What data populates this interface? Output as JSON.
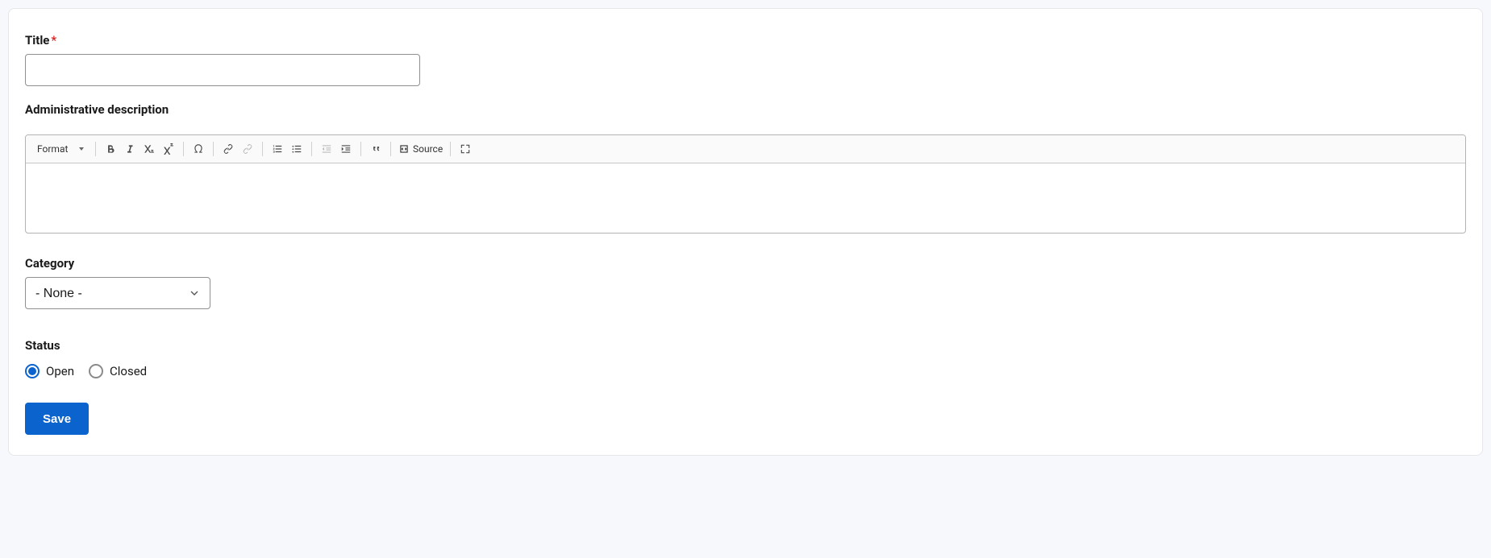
{
  "form": {
    "title": {
      "label": "Title",
      "required": "*",
      "value": ""
    },
    "description": {
      "label": "Administrative description",
      "toolbar": {
        "format_label": "Format",
        "source_label": "Source"
      },
      "value": ""
    },
    "category": {
      "label": "Category",
      "selected": "- None -"
    },
    "status": {
      "label": "Status",
      "options": {
        "open": "Open",
        "closed": "Closed"
      },
      "selected": "open"
    },
    "save_label": "Save"
  }
}
